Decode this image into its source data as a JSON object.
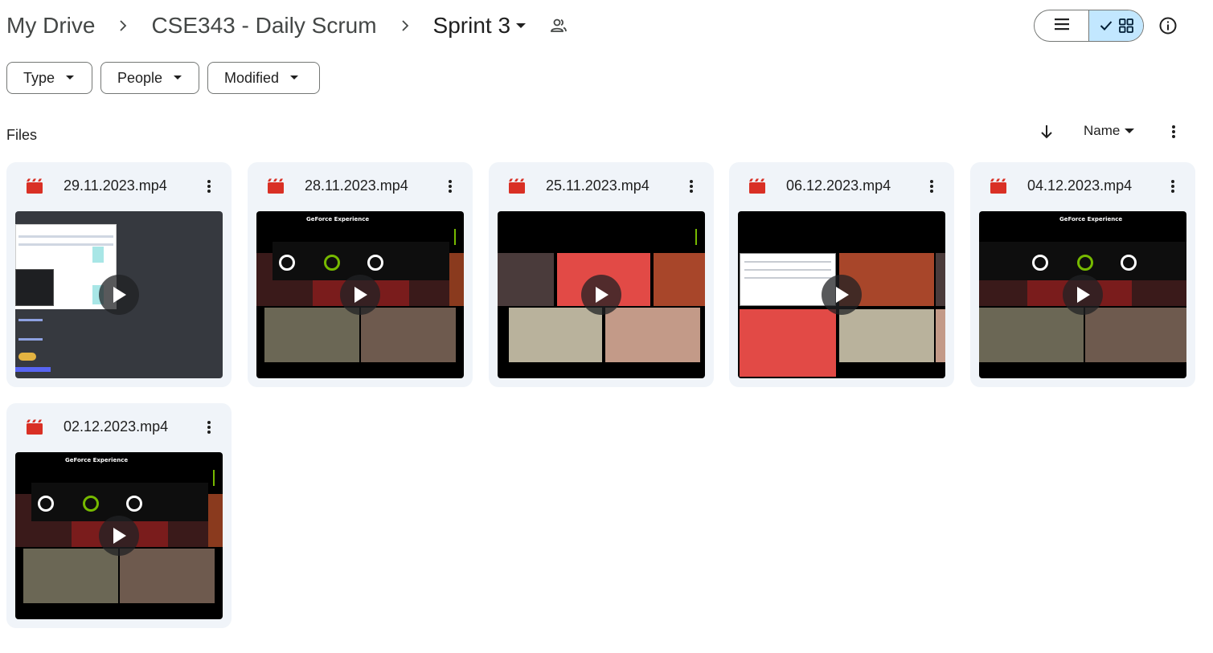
{
  "breadcrumb": {
    "items": [
      "My Drive",
      "CSE343 - Daily Scrum",
      "Sprint 3"
    ]
  },
  "header": {
    "shared_icon": "people-icon",
    "view_list_icon": "list-icon",
    "view_grid_icon": "grid-icon",
    "info_icon": "info-icon"
  },
  "filters": {
    "chips": [
      {
        "label": "Type"
      },
      {
        "label": "People"
      },
      {
        "label": "Modified"
      }
    ]
  },
  "files_section": {
    "label": "Files",
    "sort_label": "Name",
    "sort_direction": "descending"
  },
  "files": [
    {
      "name": "29.11.2023.mp4",
      "thumb": "screen-share"
    },
    {
      "name": "28.11.2023.mp4",
      "thumb": "geforce",
      "overlay_title": "GeForce Experience"
    },
    {
      "name": "25.11.2023.mp4",
      "thumb": "call-grid"
    },
    {
      "name": "06.12.2023.mp4",
      "thumb": "call-share"
    },
    {
      "name": "04.12.2023.mp4",
      "thumb": "geforce",
      "overlay_title": "GeForce Experience"
    },
    {
      "name": "02.12.2023.mp4",
      "thumb": "geforce",
      "overlay_title": "GeForce Experience"
    }
  ],
  "colors": {
    "video_icon": "#d93025",
    "card_bg": "#f0f4f9",
    "active_toggle": "#c2e7ff"
  }
}
